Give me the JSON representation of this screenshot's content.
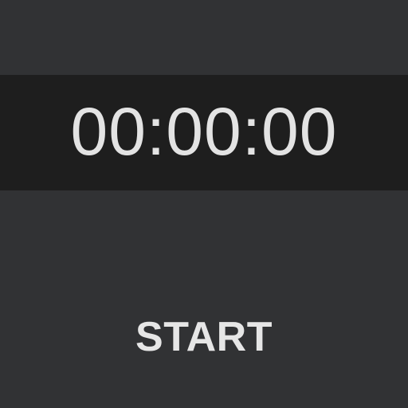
{
  "timer": {
    "display": "00:00:00"
  },
  "controls": {
    "start_label": "START"
  },
  "colors": {
    "background": "#313234",
    "timer_band": "#1e1e1e",
    "text": "#e3e3e3"
  }
}
